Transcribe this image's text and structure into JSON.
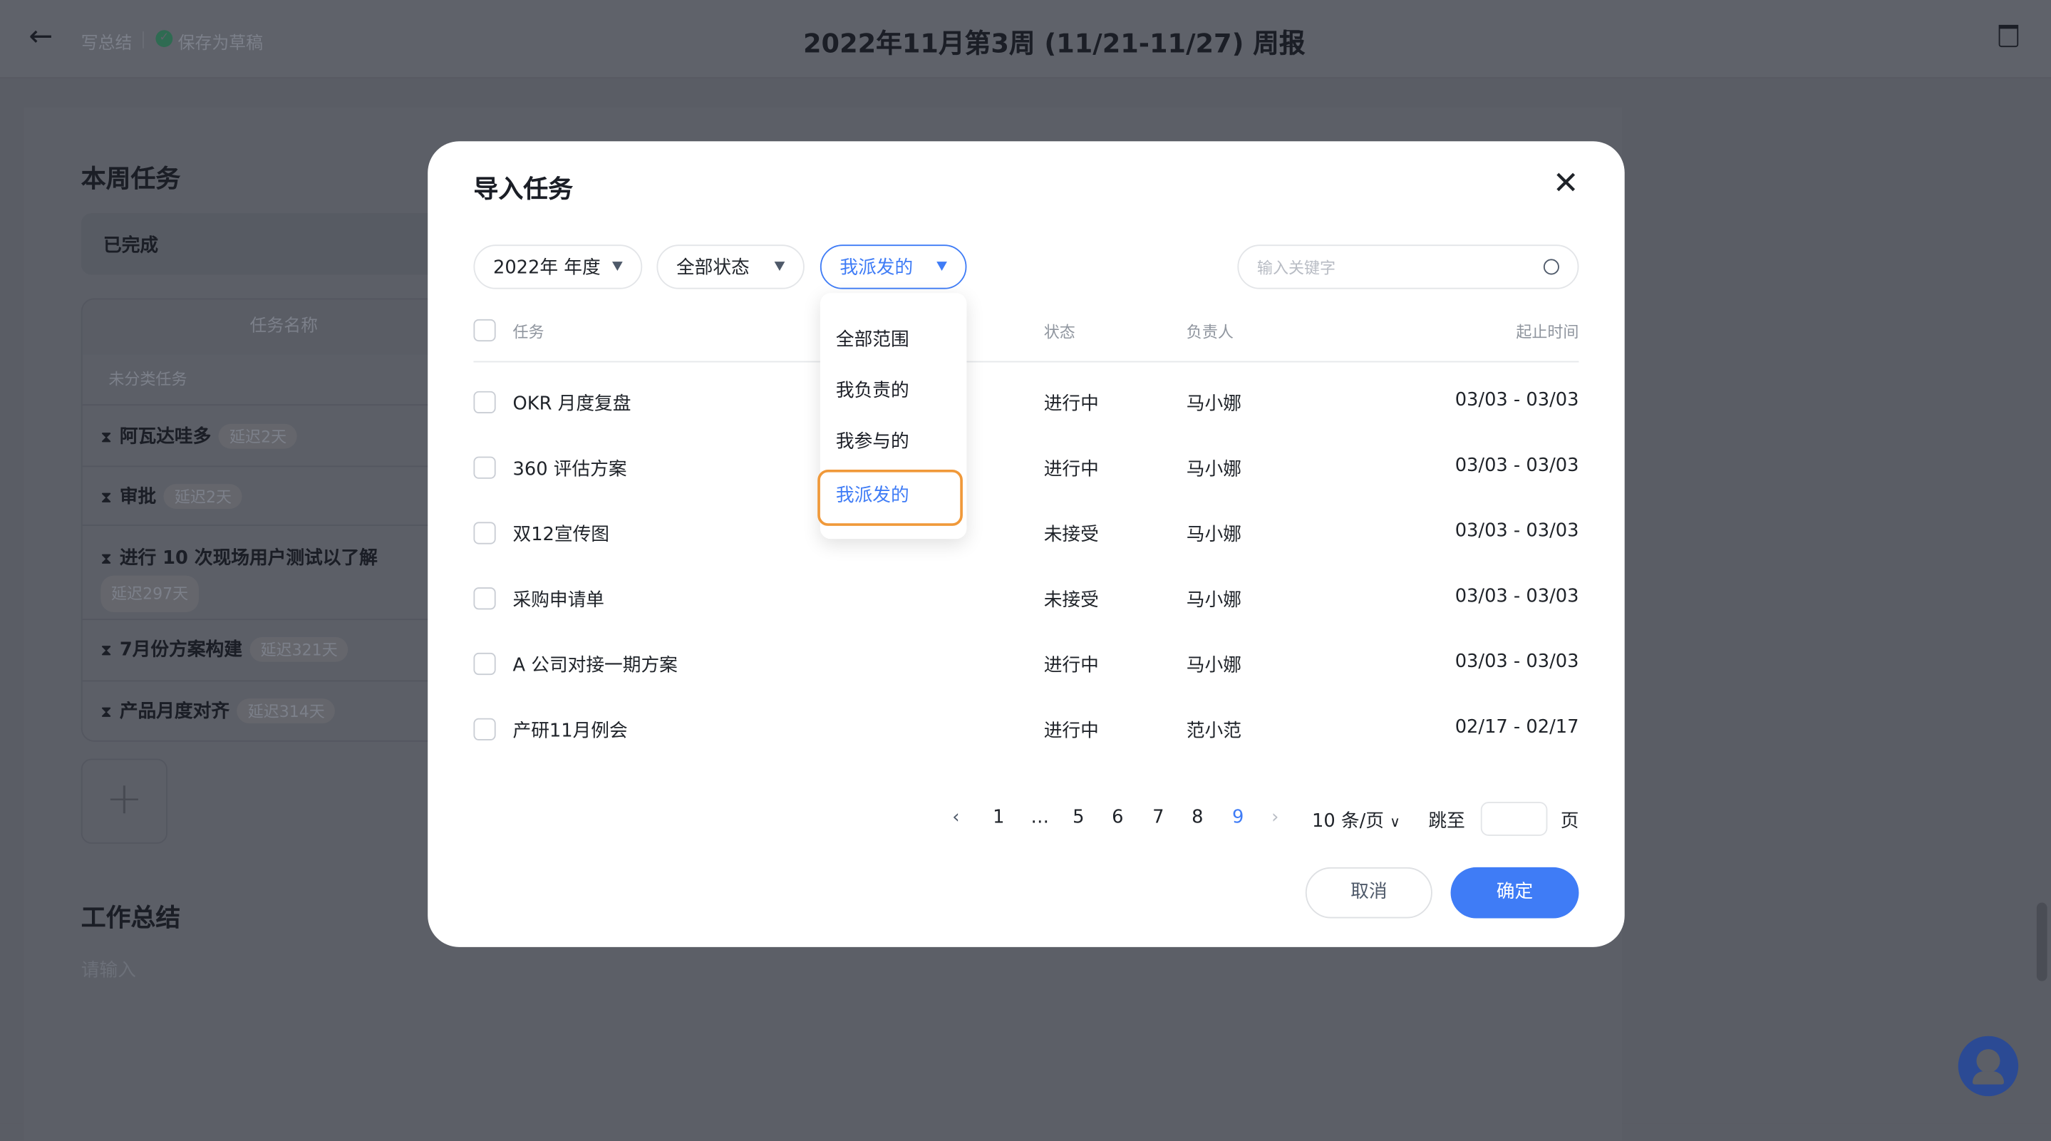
{
  "header": {
    "back_icon": "arrow-left-icon",
    "write_summary": "写总结",
    "saved_status": "保存为草稿",
    "title": "2022年11月第3周 (11/21-11/27) 周报",
    "title_icon": "document-icon",
    "trash_icon": "trash-icon"
  },
  "page": {
    "section_title": "本周任务",
    "completed_group": "已完成",
    "table_header": "任务名称",
    "uncategorized": "未分类任务",
    "tasks": [
      {
        "name": "阿瓦达哇多",
        "delay": "延迟2天"
      },
      {
        "name": "审批",
        "delay": "延迟2天"
      },
      {
        "name": "进行 10 次现场用户测试以了解",
        "delay": "延迟297天"
      },
      {
        "name": "7月份方案构建",
        "delay": "延迟321天"
      },
      {
        "name": "产品月度对齐",
        "delay": "延迟314天"
      }
    ],
    "add_icon": "plus-icon",
    "summary_title": "工作总结",
    "summary_placeholder": "请输入"
  },
  "modal": {
    "title": "导入任务",
    "close_icon": "close-icon",
    "filters": {
      "year": "2022年 年度",
      "status": "全部状态",
      "scope": "我派发的",
      "search_placeholder": "输入关键字"
    },
    "scope_options": [
      "全部范围",
      "我负责的",
      "我参与的",
      "我派发的"
    ],
    "scope_selected": "我派发的",
    "columns": {
      "task": "任务",
      "status": "状态",
      "owner": "负责人",
      "period": "起止时间"
    },
    "rows": [
      {
        "task": "OKR 月度复盘",
        "status": "进行中",
        "owner": "马小娜",
        "period": "03/03 - 03/03"
      },
      {
        "task": "360 评估方案",
        "status": "进行中",
        "owner": "马小娜",
        "period": "03/03 - 03/03"
      },
      {
        "task": "双12宣传图",
        "status": "未接受",
        "owner": "马小娜",
        "period": "03/03 - 03/03"
      },
      {
        "task": "采购申请单",
        "status": "未接受",
        "owner": "马小娜",
        "period": "03/03 - 03/03"
      },
      {
        "task": "A 公司对接一期方案",
        "status": "进行中",
        "owner": "马小娜",
        "period": "03/03 - 03/03"
      },
      {
        "task": "产研11月例会",
        "status": "进行中",
        "owner": "范小范",
        "period": "02/17 - 02/17"
      }
    ],
    "pagination": {
      "pages": [
        "1",
        "…",
        "5",
        "6",
        "7",
        "8",
        "9"
      ],
      "current": "9",
      "page_size": "10 条/页",
      "jump_label": "跳至",
      "page_suffix": "页"
    },
    "cancel": "取消",
    "confirm": "确定"
  },
  "colors": {
    "accent": "#3f7cf6",
    "highlight_border": "#f0993a",
    "success": "#34a853"
  },
  "support_icon": "customer-service-icon"
}
